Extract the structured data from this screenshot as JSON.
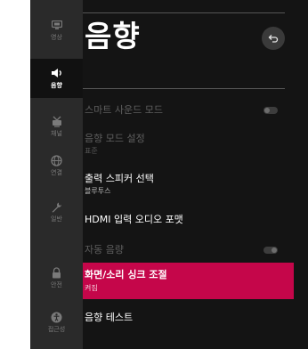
{
  "sidebar": {
    "items": [
      {
        "label": "영상",
        "icon": "picture-icon",
        "active": false
      },
      {
        "label": "음향",
        "icon": "speaker-icon",
        "active": true
      },
      {
        "label": "채널",
        "icon": "antenna-icon",
        "active": false
      },
      {
        "label": "연결",
        "icon": "network-icon",
        "active": false
      },
      {
        "label": "일반",
        "icon": "wrench-icon",
        "active": false
      },
      {
        "label": "안전",
        "icon": "lock-icon",
        "active": false
      },
      {
        "label": "접근성",
        "icon": "accessibility-icon",
        "active": false
      }
    ]
  },
  "header": {
    "title": "음향",
    "back_icon": "back-icon"
  },
  "settings": [
    {
      "label": "스마트 사운드 모드",
      "sub": "",
      "enabled": false,
      "toggle": "off"
    },
    {
      "label": "음향 모드 설정",
      "sub": "표준",
      "enabled": false
    },
    {
      "label": "출력 스피커 선택",
      "sub": "블루투스",
      "enabled": true
    },
    {
      "label": "HDMI 입력 오디오 포맷",
      "sub": "",
      "enabled": true
    },
    {
      "label": "자동 음량",
      "sub": "",
      "enabled": false,
      "toggle": "on"
    },
    {
      "label": "화면/소리 싱크 조절",
      "sub": "켜짐",
      "enabled": true,
      "selected": true
    },
    {
      "label": "음향 테스트",
      "sub": "",
      "enabled": true
    }
  ],
  "colors": {
    "selection": "#c5064a",
    "background": "#141414",
    "sidebar": "#2a2a2a"
  }
}
